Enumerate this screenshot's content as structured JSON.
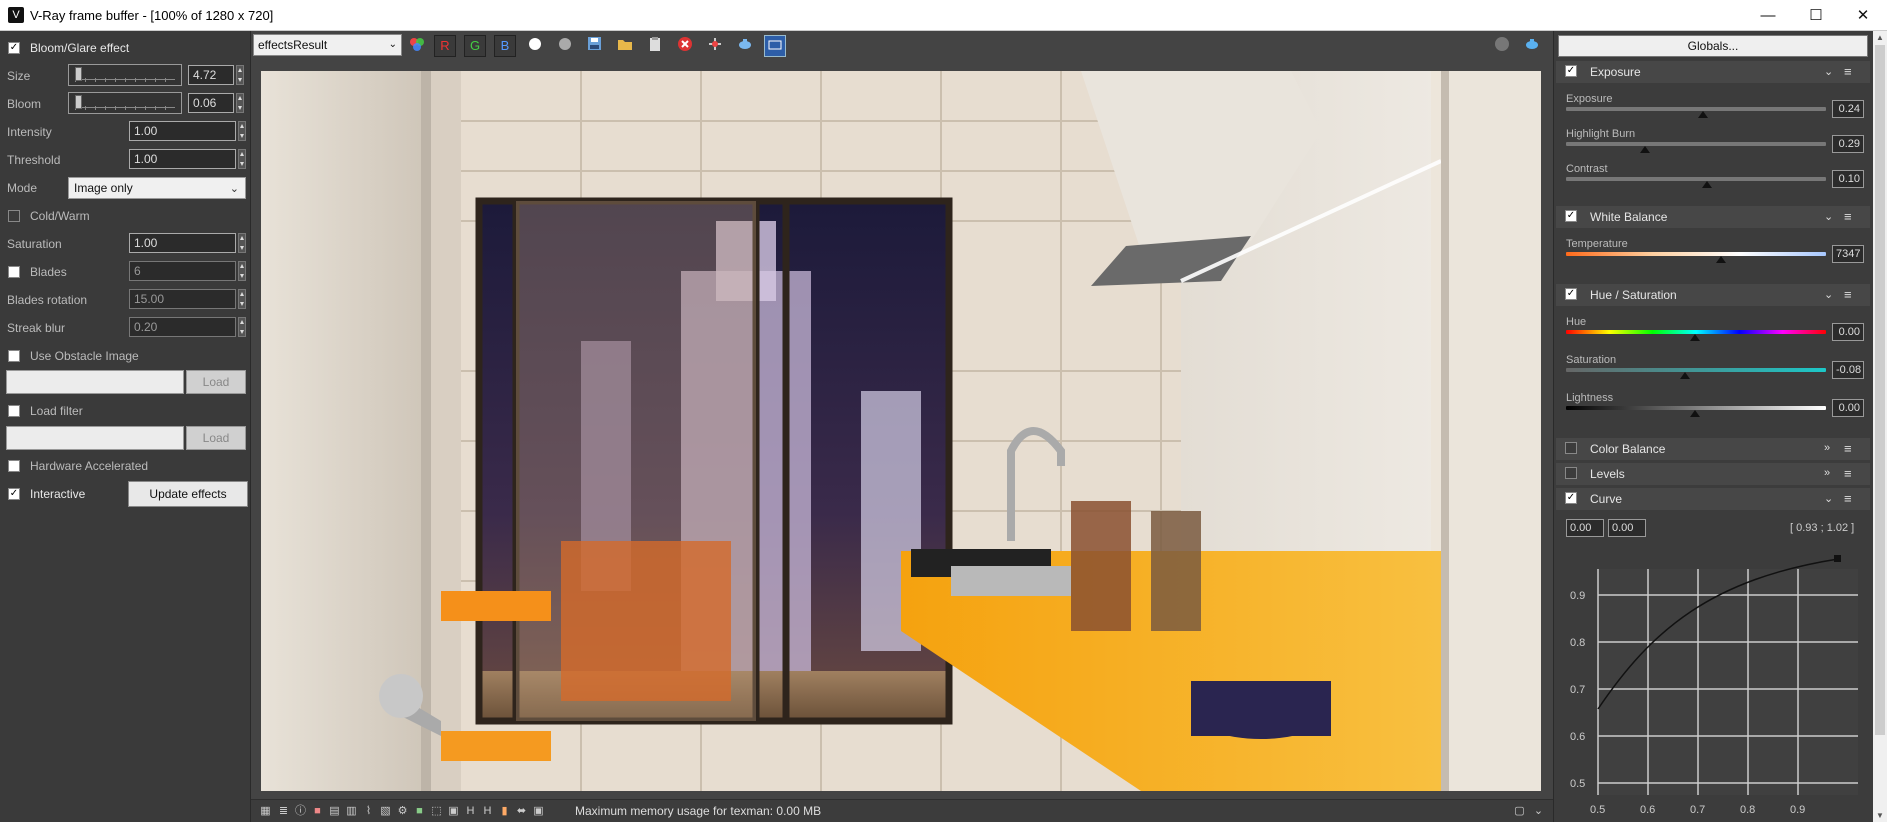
{
  "window": {
    "title": "V-Ray frame buffer - [100% of 1280 x 720]",
    "minimize": "—",
    "maximize": "☐",
    "close": "✕"
  },
  "left": {
    "bloom_glare": "Bloom/Glare effect",
    "size_label": "Size",
    "size_value": "4.72",
    "bloom_label": "Bloom",
    "bloom_value": "0.06",
    "intensity_label": "Intensity",
    "intensity_value": "1.00",
    "threshold_label": "Threshold",
    "threshold_value": "1.00",
    "mode_label": "Mode",
    "mode_value": "Image only",
    "cold_warm": "Cold/Warm",
    "saturation_label": "Saturation",
    "saturation_value": "1.00",
    "blades_label": "Blades",
    "blades_value": "6",
    "blades_rotation_label": "Blades rotation",
    "blades_rotation_value": "15.00",
    "streak_blur_label": "Streak blur",
    "streak_blur_value": "0.20",
    "use_obstacle": "Use Obstacle Image",
    "load": "Load",
    "load_filter": "Load filter",
    "hw_accel": "Hardware Accelerated",
    "interactive": "Interactive",
    "update_effects": "Update effects"
  },
  "toolbar": {
    "channel": "effectsResult",
    "r": "R",
    "g": "G",
    "b": "B"
  },
  "status": {
    "text": "Maximum memory usage for texman: 0.00 MB"
  },
  "right": {
    "globals": "Globals...",
    "exposure_section": "Exposure",
    "exposure_label": "Exposure",
    "exposure_value": "0.24",
    "highlight_label": "Highlight Burn",
    "highlight_value": "0.29",
    "contrast_label": "Contrast",
    "contrast_value": "0.10",
    "wb_section": "White Balance",
    "temperature_label": "Temperature",
    "temperature_value": "7347",
    "hs_section": "Hue / Saturation",
    "hue_label": "Hue",
    "hue_value": "0.00",
    "sat_label": "Saturation",
    "sat_value": "-0.08",
    "light_label": "Lightness",
    "light_value": "0.00",
    "cb_section": "Color Balance",
    "levels_section": "Levels",
    "curve_section": "Curve",
    "curve_in_x": "0.00",
    "curve_in_y": "0.00",
    "curve_coord": "[ 0.93 ; 1.02 ]",
    "curve_y_ticks": [
      "0.9",
      "0.8",
      "0.7",
      "0.6",
      "0.5"
    ],
    "curve_x_ticks": [
      "0.5",
      "0.6",
      "0.7",
      "0.8",
      "0.9"
    ]
  }
}
